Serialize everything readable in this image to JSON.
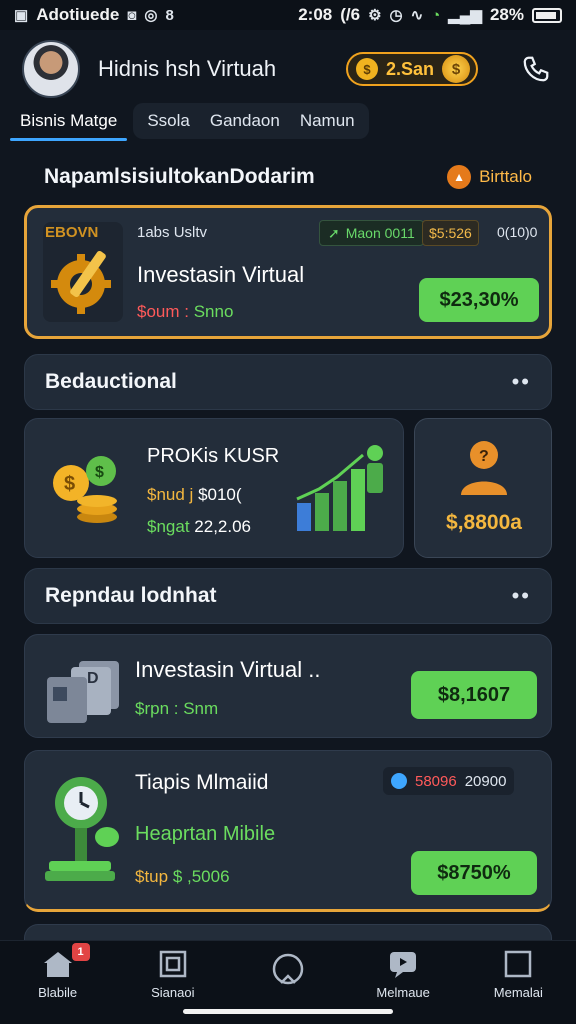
{
  "status_bar": {
    "app_name": "Adotiuede",
    "time": "2:08",
    "indicator": "(/6",
    "battery_percent": "28%",
    "left_glyphs": [
      "image-icon",
      "alert-icon",
      "sync-icon"
    ],
    "right_glyphs": [
      "settings-icon",
      "alarm-icon",
      "nfc-icon",
      "wifi-icon",
      "signal-icon"
    ]
  },
  "header": {
    "title": "Hidnis hsh Virtuah",
    "coin_value": "2.San",
    "coin_small_symbol": "$",
    "coin_big_symbol": "$"
  },
  "tabs": [
    {
      "label": "Bisnis Matge",
      "active": true
    },
    {
      "label": "Ssola",
      "active": false
    },
    {
      "label": "Gandaon",
      "active": false
    },
    {
      "label": "Namun",
      "active": false
    }
  ],
  "section1": {
    "title": "NapamlsisiultokanDodarim",
    "link_label": "Birttalo"
  },
  "featured": {
    "logo_text": "EBOVN",
    "meta": "1abs Usltv",
    "tag_green": "Maon 0011",
    "tag_gold": "$5:526",
    "tag_plain": "0(10)0",
    "title": "Investasin Virtual",
    "sub_red": "$oum :",
    "sub_green": "Snno",
    "button": "$23,30%"
  },
  "section2": {
    "title": "Bedauctional",
    "dots": "••"
  },
  "profit_card": {
    "title": "PROKis KUSR",
    "line1_gold": "$nud j",
    "line1_value": "$010(",
    "line2_green": "$ngat",
    "line2_value": "22,2.06"
  },
  "side_card": {
    "value": "$,8800a"
  },
  "section3": {
    "title": "Repndau lodnhat",
    "dots": "••"
  },
  "list_items": [
    {
      "title": "Investasin Virtual ..",
      "sub_label": "$rpn :",
      "sub_value": "Snm",
      "button": "$8,1607"
    },
    {
      "title": "Tiapis Mlmaiid",
      "subtitle": "Heaprtan Mibile",
      "sub_label": "$tup",
      "sub_value": "$ ,5006",
      "tag_red": "58096",
      "tag_plain": "20900",
      "button": "$8750%"
    }
  ],
  "bottom_nav": [
    {
      "label": "Blabile",
      "icon": "home-icon",
      "badge": "1"
    },
    {
      "label": "Sianaoi",
      "icon": "grid-icon"
    },
    {
      "label": "",
      "icon": "profile-icon"
    },
    {
      "label": "Melmaue",
      "icon": "chat-icon"
    },
    {
      "label": "Memalai",
      "icon": "square-icon"
    }
  ],
  "colors": {
    "background": "#10161f",
    "card": "#232d3a",
    "accent_green": "#5fd155",
    "accent_gold": "#f4b73f",
    "accent_blue": "#3ea6ff",
    "accent_red": "#ff5a5a"
  }
}
